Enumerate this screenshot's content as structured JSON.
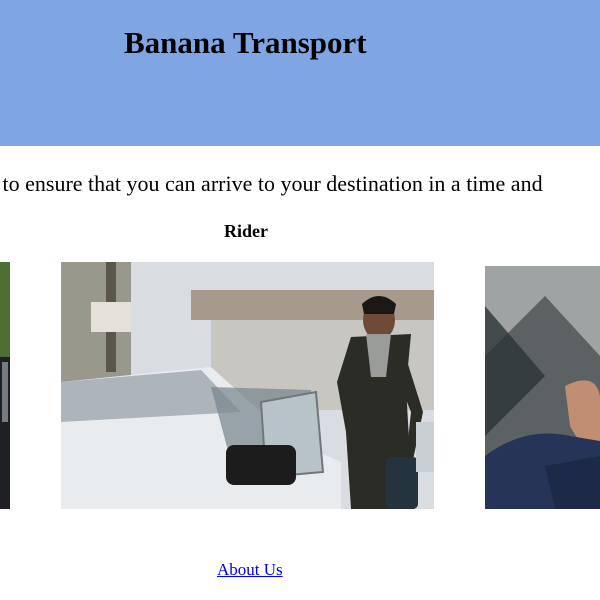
{
  "header": {
    "title": "Banana Transport",
    "background_color": "#7fa6e3"
  },
  "intro": {
    "tagline": "k to ensure that you can arrive to your destination in a time and"
  },
  "section": {
    "label": "Rider"
  },
  "photos": [
    {
      "subject": "car-interior-green-partial"
    },
    {
      "subject": "man-entering-white-car"
    },
    {
      "subject": "man-in-navy-suit-partial"
    }
  ],
  "footer": {
    "about_link": "About Us",
    "link_color": "#0000ee"
  }
}
